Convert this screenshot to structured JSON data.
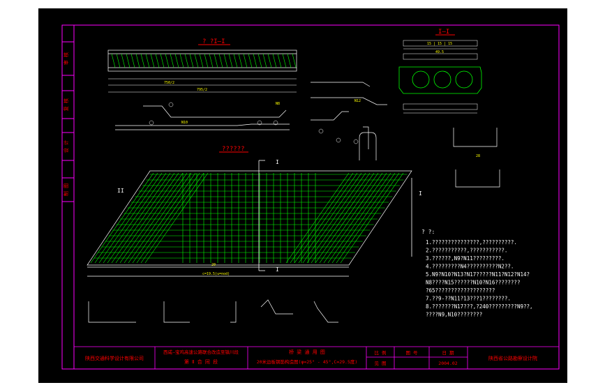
{
  "colors": {
    "background": "#000000",
    "border": "#ff00ff",
    "rebar": "#00ff00",
    "text": "#ffff00",
    "title": "#ff0000",
    "dim": "#00ffff",
    "lines": "#ffffff"
  },
  "section_title": "? ?I—I",
  "section_label": "I—I",
  "plan_title": "??????",
  "marker_I": "I",
  "marker_II": "II",
  "side_tabs": [
    "审 核",
    "复 核",
    "设 计",
    "制 图"
  ],
  "notes": {
    "head": "? ?:",
    "lines": [
      "1.???????????????,??????????.",
      "2.???????????,???????????.",
      "3.??????,N9?N11?????????.",
      "4.?????????N4??????????N2??.",
      "5.N9?N10?N13?N17?????N11?N12?N14?",
      "  N8????N15??????N10?N16????????",
      "  ?65???????????????????",
      "7.??9-??N11?13???1????????.",
      "8.???????N17???,?240?????????N9??,",
      "  ????N9,N10????????"
    ]
  },
  "title_block": {
    "company": "陕西交通科学设计有限公司",
    "project_1": "西咸—宝鸡高速公路联合改造至镇川段",
    "project_2": "第 Ⅱ 合 同 段",
    "drawing_1": "桥 梁 通 用 图",
    "drawing_2": "20米边板钢筋构造图(φ=25° - 45°,C=29.5度)",
    "cell_scale": "比 例",
    "cell_sheet": "图 号",
    "cell_date": "日 期",
    "cell_view": "见 图",
    "date": "2004.02",
    "institute": "陕西省公路勘察设计院"
  },
  "dims": {
    "plan_length": "20",
    "plan_chain": "c=19.5(u=nod)",
    "section_w": "49.5",
    "section_sub": "15 | 15 | 15",
    "d1": "750/2",
    "d2": "795/2",
    "d3": "28",
    "n10": "N10",
    "n8": "N8",
    "n12": "N12"
  }
}
